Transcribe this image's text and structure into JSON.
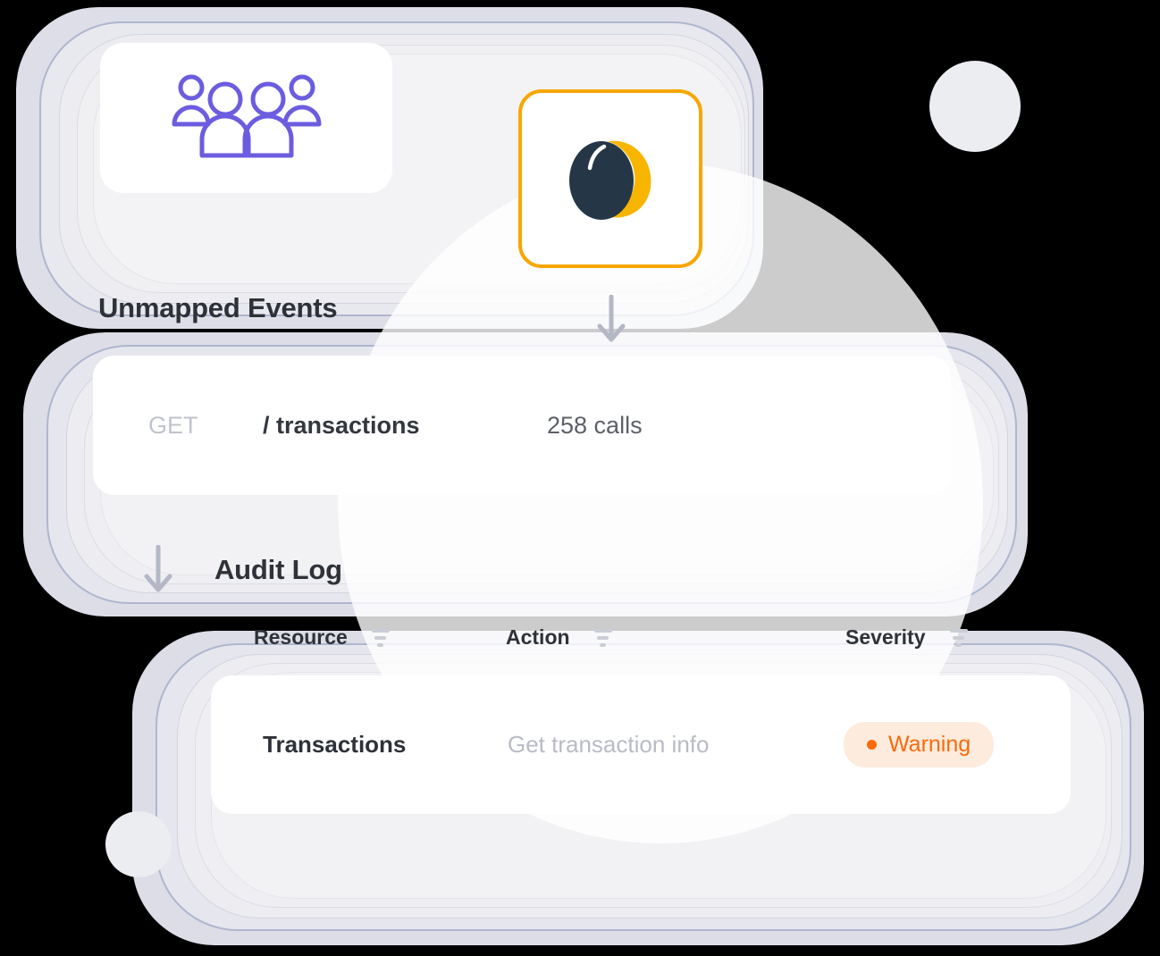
{
  "colors": {
    "accent_orange": "#F7A600",
    "badge_text": "#F96A0B",
    "badge_bg": "#FDEBDE",
    "people_icon": "#6C5CE0",
    "egg_dark": "#253746",
    "egg_yellow": "#F7B500",
    "title_text": "#2E3238",
    "muted_text": "#B9BCC6",
    "layer_border": "#AEB6D0",
    "layer_fill": "#DEDFE7",
    "circle_fill": "#ECEDF0"
  },
  "sections": {
    "unmapped": {
      "title": "Unmapped Events",
      "people_icon_name": "people-group-icon",
      "integration_icon_name": "egg-logo-icon"
    },
    "endpoint": {
      "method": "GET",
      "path": "/ transactions",
      "calls": "258 calls"
    },
    "audit": {
      "title": "Audit Log",
      "columns": [
        {
          "label": "Resource",
          "filter_icon": "filter-icon"
        },
        {
          "label": "Action",
          "filter_icon": "filter-icon"
        },
        {
          "label": "Severity",
          "filter_icon": "filter-icon"
        }
      ],
      "rows": [
        {
          "resource": "Transactions",
          "action": "Get transaction info",
          "severity": "Warning"
        }
      ]
    }
  },
  "arrows": {
    "integration_to_endpoint": "arrow-down-icon",
    "endpoint_to_audit": "arrow-down-icon"
  }
}
